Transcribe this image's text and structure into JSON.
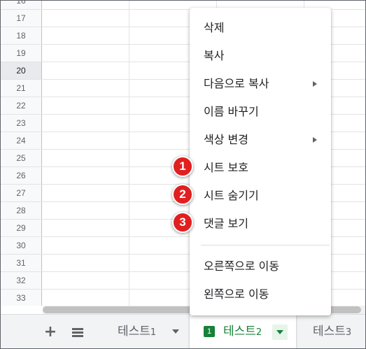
{
  "rows": [
    "17",
    "18",
    "19",
    "20",
    "21",
    "22",
    "23",
    "24",
    "25",
    "26",
    "27",
    "28",
    "29",
    "30",
    "31",
    "32",
    "33"
  ],
  "selected_row": "20",
  "context_menu": {
    "delete": "삭제",
    "copy": "복사",
    "copy_to": "다음으로 복사",
    "rename": "이름 바꾸기",
    "change_color": "색상 변경",
    "protect_sheet": "시트 보호",
    "hide_sheet": "시트 숨기기",
    "view_comments": "댓글 보기",
    "move_right": "오른쪽으로 이동",
    "move_left": "왼쪽으로 이동"
  },
  "badges": {
    "b1": "1",
    "b2": "2",
    "b3": "3"
  },
  "sheet_bar": {
    "add_sheet": "+",
    "tabs": [
      {
        "name": "테스트",
        "num": "1"
      },
      {
        "name": "테스트",
        "num": "2",
        "active": true,
        "protected_marker": "1"
      },
      {
        "name": "테스트",
        "num": "3"
      }
    ]
  },
  "colors": {
    "accent_green": "#188038",
    "badge_red": "#e02020"
  }
}
